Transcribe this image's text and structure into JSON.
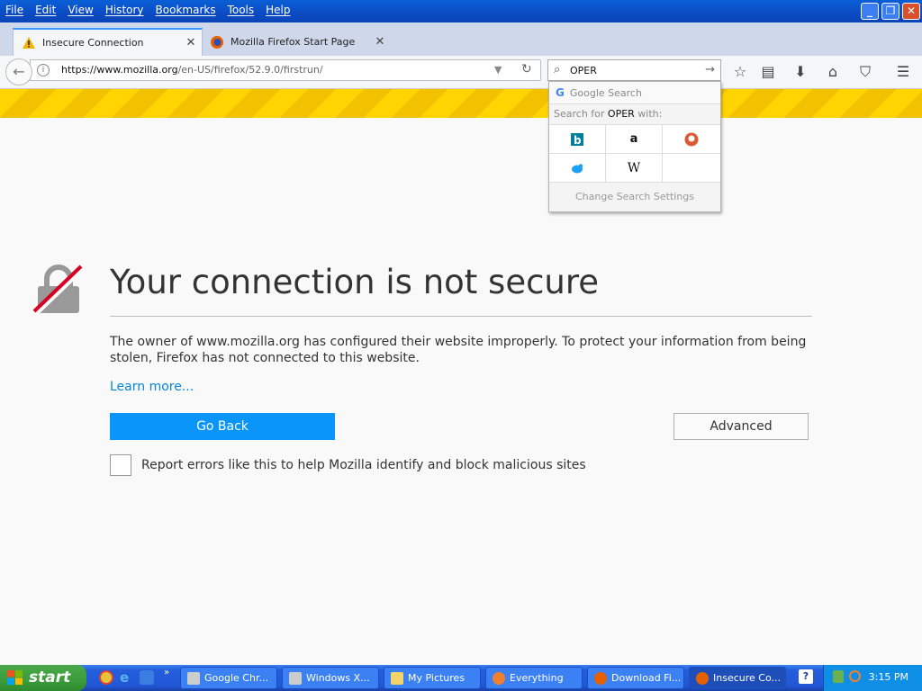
{
  "menu": [
    "File",
    "Edit",
    "View",
    "History",
    "Bookmarks",
    "Tools",
    "Help"
  ],
  "tabs": [
    {
      "title": "Insecure Connection",
      "active": true
    },
    {
      "title": "Mozilla Firefox Start Page",
      "active": false
    }
  ],
  "urlbar": {
    "domain": "https://www.mozilla.org",
    "path": "/en-US/firefox/52.9.0/firstrun/"
  },
  "search": {
    "value": "OPER",
    "popup_engine": "Google Search",
    "search_for_prefix": "Search for ",
    "search_for_suffix": " with:",
    "engines": [
      "bing",
      "amazon",
      "duckduckgo",
      "twitter",
      "wikipedia"
    ],
    "settings_label": "Change Search Settings"
  },
  "error": {
    "title": "Your connection is not secure",
    "description": "The owner of www.mozilla.org has configured their website improperly. To protect your information from being stolen, Firefox has not connected to this website.",
    "learn_more": "Learn more...",
    "go_back": "Go Back",
    "advanced": "Advanced",
    "report_label": "Report errors like this to help Mozilla identify and block malicious sites"
  },
  "taskbar": {
    "start_label": "start",
    "tasks": [
      {
        "label": "Google Chr...",
        "active": false
      },
      {
        "label": "Windows X...",
        "active": false
      },
      {
        "label": "My Pictures",
        "active": false
      },
      {
        "label": "Everything",
        "active": false
      },
      {
        "label": "Download Fi...",
        "active": false
      },
      {
        "label": "Insecure Co...",
        "active": true
      }
    ],
    "clock": "3:15 PM"
  },
  "colors": {
    "accent": "#0996f8",
    "stripe": "#ffd400",
    "taskbar": "#245edb",
    "start": "#3a9c3a"
  }
}
